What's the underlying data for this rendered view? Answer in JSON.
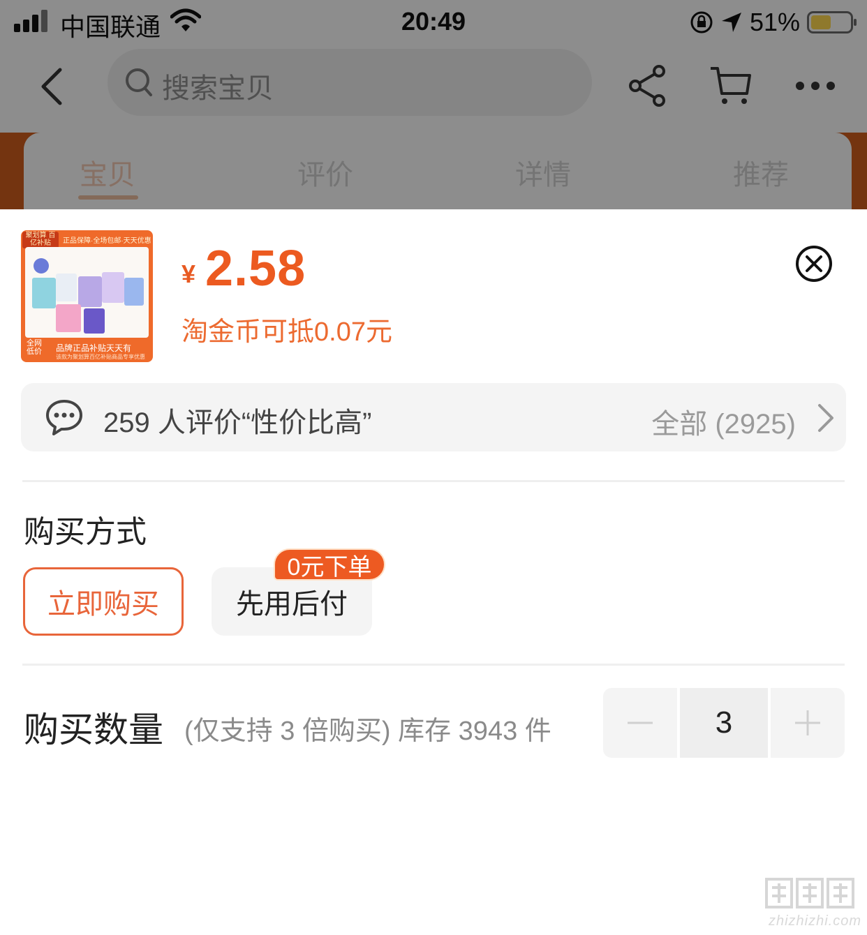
{
  "status_bar": {
    "carrier": "中国联通",
    "time": "20:49",
    "battery_pct": "51%"
  },
  "nav": {
    "search_placeholder": "搜索宝贝",
    "icons": [
      "back-icon",
      "search-icon",
      "share-icon",
      "cart-icon",
      "more-icon"
    ]
  },
  "tabs": [
    {
      "label": "宝贝",
      "active": true
    },
    {
      "label": "评价",
      "active": false
    },
    {
      "label": "详情",
      "active": false
    },
    {
      "label": "推荐",
      "active": false
    }
  ],
  "product": {
    "thumbnail": {
      "badge": "聚划算 百亿补贴",
      "slogan": "正品保障·全场包邮·天天优惠",
      "corner": "全网低价",
      "subtitle": "品牌正品补贴天天有",
      "subnote": "该款为聚划算百亿补贴商品专享优惠"
    },
    "currency": "¥",
    "price": "2.58",
    "coin_deduct": "淘金币可抵0.07元"
  },
  "review": {
    "summary": "259 人评价“性价比高”",
    "all": "全部 (2925)"
  },
  "purchase_method": {
    "title": "购买方式",
    "options": [
      {
        "label": "立即购买",
        "selected": true
      },
      {
        "label": "先用后付",
        "selected": false,
        "tag": "0元下单"
      }
    ]
  },
  "quantity": {
    "title": "购买数量",
    "note": "(仅支持 3 倍购买) 库存 3943 件",
    "value": "3"
  },
  "colors": {
    "accent": "#ec5a20",
    "dim_overlay": "rgba(0,0,0,0.42)"
  },
  "watermark": "zhizhizhi.com"
}
